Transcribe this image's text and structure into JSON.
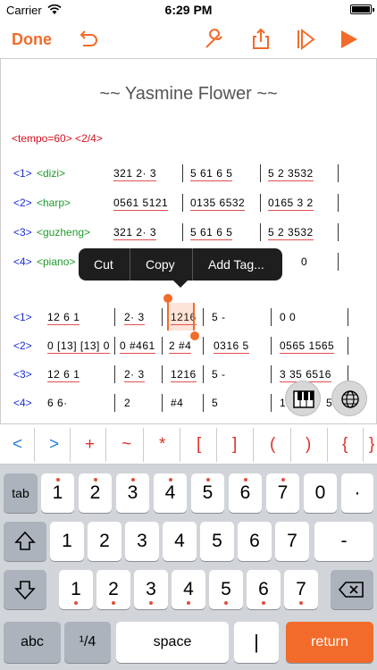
{
  "status_bar": {
    "carrier": "Carrier",
    "time": "6:29 PM"
  },
  "toolbar": {
    "done_label": "Done",
    "icons": [
      "undo-icon",
      "wrench-icon",
      "share-icon",
      "step-play-icon",
      "play-icon"
    ]
  },
  "colors": {
    "accent": "#f26b2a",
    "number": "#1a2fd0",
    "instrument": "#1e9a2a",
    "tag": "#d01020"
  },
  "score": {
    "title": "~~ Yasmine Flower ~~",
    "header": "<tempo=60> <2/4>",
    "tracks_top": [
      {
        "num": "<1>",
        "instrument": "<dizi>",
        "measures": [
          "321  2· 3",
          "5 61 6 5",
          "5 2  3532"
        ]
      },
      {
        "num": "<2>",
        "instrument": "<harp>",
        "measures": [
          "0561 5121",
          "0135 6532",
          "0165 3 2"
        ]
      },
      {
        "num": "<3>",
        "instrument": "<guzheng>",
        "measures": [
          "321  2· 3",
          "5 61 6 5",
          "5 2  3532"
        ]
      },
      {
        "num": "<4>",
        "instrument": "<piano>",
        "measures": [
          "0"
        ]
      }
    ],
    "tracks_bottom": [
      {
        "num": "<1>",
        "measures": [
          "12 6  1",
          "2· 3",
          "1216",
          "5   -",
          "0   0"
        ]
      },
      {
        "num": "<2>",
        "measures": [
          "0 [13] [13] 0",
          "0 #461",
          "2 #4",
          "0316 5",
          "0565  1565"
        ]
      },
      {
        "num": "<3>",
        "measures": [
          "12 6  1",
          "2· 3",
          "1216",
          "5   -",
          "3  35 6516"
        ]
      },
      {
        "num": "<4>",
        "measures": [
          "6  6·",
          "2",
          "#4",
          "5",
          "1",
          "5"
        ]
      }
    ]
  },
  "context_menu": {
    "items": [
      "Cut",
      "Copy",
      "Add Tag..."
    ]
  },
  "symbol_bar": {
    "symbols": [
      "<",
      ">",
      "+",
      "~",
      "*",
      "[",
      "]",
      "(",
      ")",
      "{",
      "}"
    ]
  },
  "keyboard": {
    "row1": [
      "tab",
      "1",
      "2",
      "3",
      "4",
      "5",
      "6",
      "7",
      "0",
      "·"
    ],
    "row2": [
      "1",
      "2",
      "3",
      "4",
      "5",
      "6",
      "7",
      "-"
    ],
    "row3": [
      "1",
      "2",
      "3",
      "4",
      "5",
      "6",
      "7"
    ],
    "row4": {
      "abc": "abc",
      "quarter": "¹/4",
      "space": "space",
      "return": "return"
    }
  }
}
